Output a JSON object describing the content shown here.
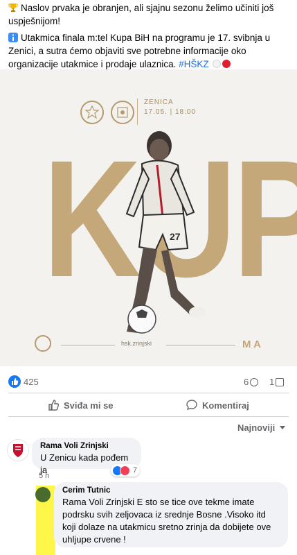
{
  "post": {
    "line1": "Naslov prvaka je obranjen, ali sjajnu sezonu želimo učiniti još uspješnijom!",
    "line2": "Utakmica finala m:tel Kupa BiH na programu je 17. svibnja u Zenici, a sutra ćemo objaviti sve potrebne informacije oko organizacije utakmice i prodaje ulaznica.",
    "hashtag": "#HŠKZ",
    "icons": [
      "trophy-icon",
      "info-icon",
      "white-circle-icon",
      "red-circle-icon"
    ]
  },
  "promo": {
    "venue": "ZENICA",
    "date_time": "17.05. | 18:00",
    "headline": "KUP",
    "jersey_number": "27",
    "handle": "hsk.zrinjski",
    "sponsor": "M A"
  },
  "stats": {
    "likes": "425",
    "comments": "6",
    "shares": "1"
  },
  "actions": {
    "like": "Sviđa mi se",
    "comment": "Komentiraj"
  },
  "sort": {
    "label": "Najnoviji"
  },
  "comments": [
    {
      "author": "Rama Voli Zrinjski",
      "text": "U Zenicu kada pođem ja",
      "time": "5 h",
      "reaction_count": "7"
    },
    {
      "author": "Cerim Tutnic",
      "text": "Rama Voli Zrinjski E sto se tice ove tekme imate podrsku svih zeljovaca iz srednje Bosne .Visoko itd koji dolaze na utakmicu sretno zrinja da dobijete ove uhljupe crvene !"
    }
  ],
  "colors": {
    "accent_blue": "#1877f2",
    "gold": "#c5a87a",
    "highlight_yellow": "#fff64a",
    "club_red": "#c8102e"
  }
}
